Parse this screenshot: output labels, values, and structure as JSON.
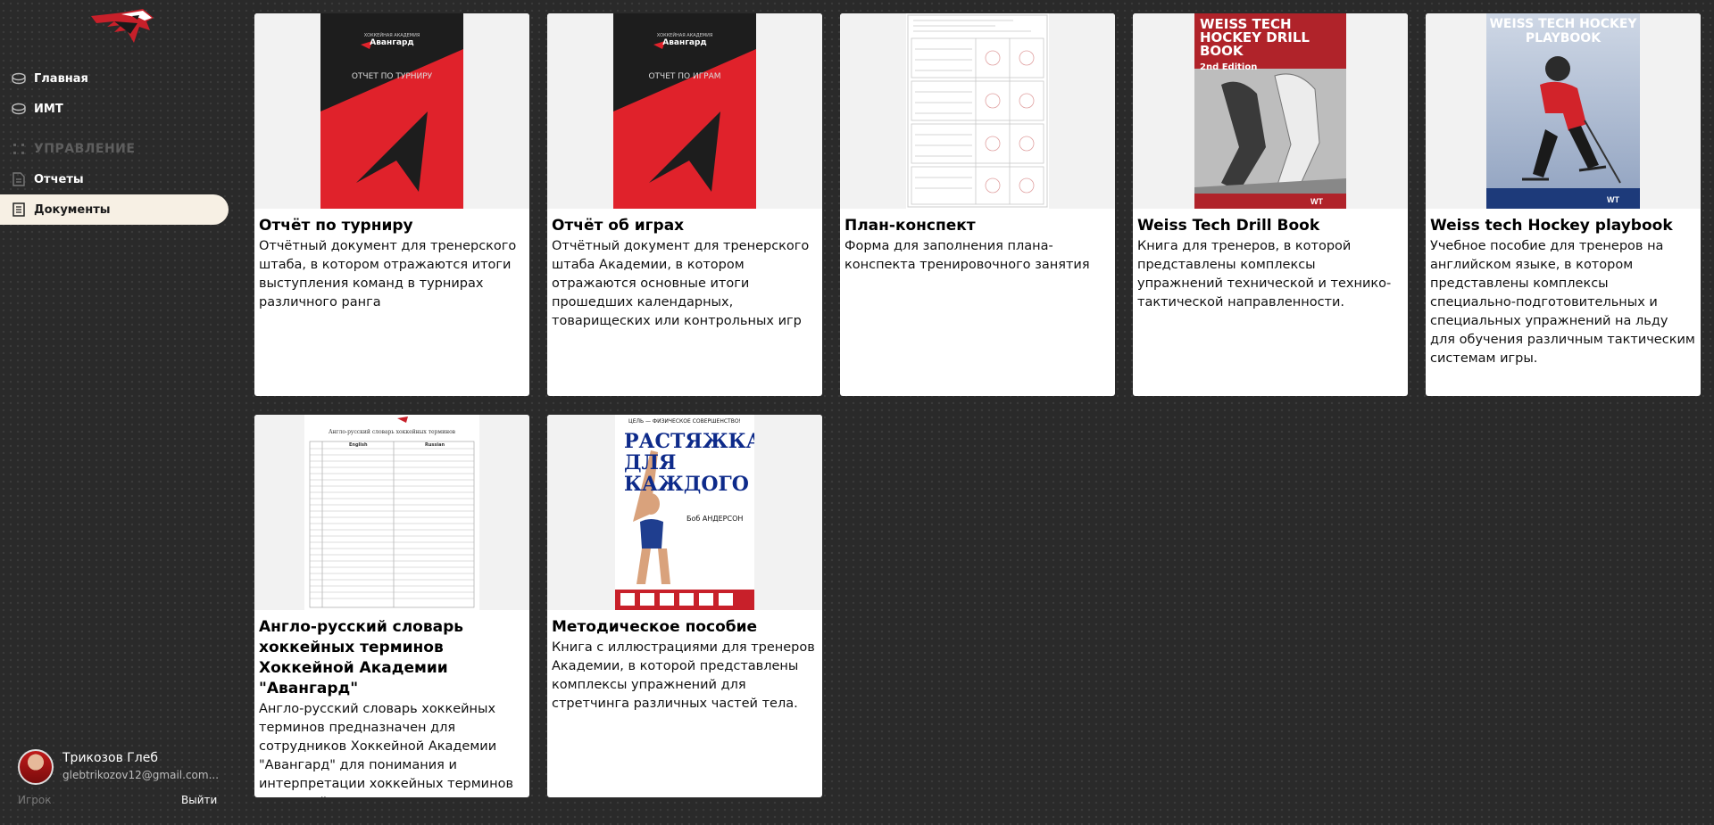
{
  "sidebar": {
    "nav": [
      {
        "label": "Главная"
      },
      {
        "label": "ИМТ"
      }
    ],
    "section_label": "УПРАВЛЕНИЕ",
    "section_items": [
      {
        "label": "Отчеты"
      },
      {
        "label": "Документы",
        "active": true
      }
    ],
    "user": {
      "name": "Трикозов Глеб",
      "email": "glebtrikozov12@gmail.com...",
      "role": "Игрок",
      "logout_label": "Выйти"
    }
  },
  "documents": [
    {
      "title": "Отчёт по турниру",
      "description": "Отчётный документ для тренерского штаба, в котором отражаются итоги выступления команд в турнирах различного ранга",
      "cover": {
        "style": "avangard",
        "brand": "Авангард",
        "brand_sub": "ХОККЕЙНАЯ АКАДЕМИЯ",
        "title": "ОТЧЕТ ПО ТУРНИРУ"
      }
    },
    {
      "title": "Отчёт об играх",
      "description": "Отчётный документ для тренерского штаба Академии, в котором отражаются основные итоги прошедших календарных, товарищеских или контрольных игр",
      "cover": {
        "style": "avangard",
        "brand": "Авангард",
        "brand_sub": "ХОККЕЙНАЯ АКАДЕМИЯ",
        "title": "ОТЧЕТ ПО ИГРАМ"
      }
    },
    {
      "title": "План-конспект",
      "description": "Форма для заполнения плана-конспекта тренировочного занятия",
      "cover": {
        "style": "plan"
      }
    },
    {
      "title": "Weiss Tech Drill Book",
      "description": "Книга для тренеров, в которой представлены комплексы упражнений технической и технико-тактической направленности.",
      "cover": {
        "style": "weiss",
        "title": "WEISS TECH HOCKEY DRILL BOOK",
        "edition": "2nd Edition"
      }
    },
    {
      "title": "Weiss tech Hockey playbook",
      "description": "Учебное пособие для тренеров на английском языке, в котором представлены комплексы специально-подготовительных и специальных упражнений на льду для обучения различным тактическим системам игры.",
      "cover": {
        "style": "playbook",
        "title": "WEISS TECH HOCKEY PLAYBOOK"
      }
    },
    {
      "title": "Англо-русский словарь хоккейных терминов Хоккейной Академии \"Авангард\"",
      "description": "Англо-русский словарь хоккейных терминов предназначен для сотрудников Хоккейной Академии \"Авангард\" для понимания и интерпретации хоккейных терминов на английском языке.",
      "cover": {
        "style": "dict",
        "title": "Англо-русский словарь хоккейных терминов",
        "col1": "English",
        "col2": "Russian"
      }
    },
    {
      "title": "Методическое пособие",
      "description": "Книга с иллюстрациями для тренеров Академии, в которой представлены комплексы упражнений для стретчинга различных частей тела.",
      "cover": {
        "style": "stretch",
        "top": "ЦЕЛЬ — ФИЗИЧЕСКОЕ СОВЕРШЕНСТВО!",
        "title": "РАСТЯЖКА ДЛЯ КАЖДОГО",
        "author": "Боб АНДЕРСОН"
      }
    }
  ],
  "colors": {
    "accent": "#f7f0e4",
    "brand_red": "#e0222b",
    "background": "#2a2a2a"
  }
}
